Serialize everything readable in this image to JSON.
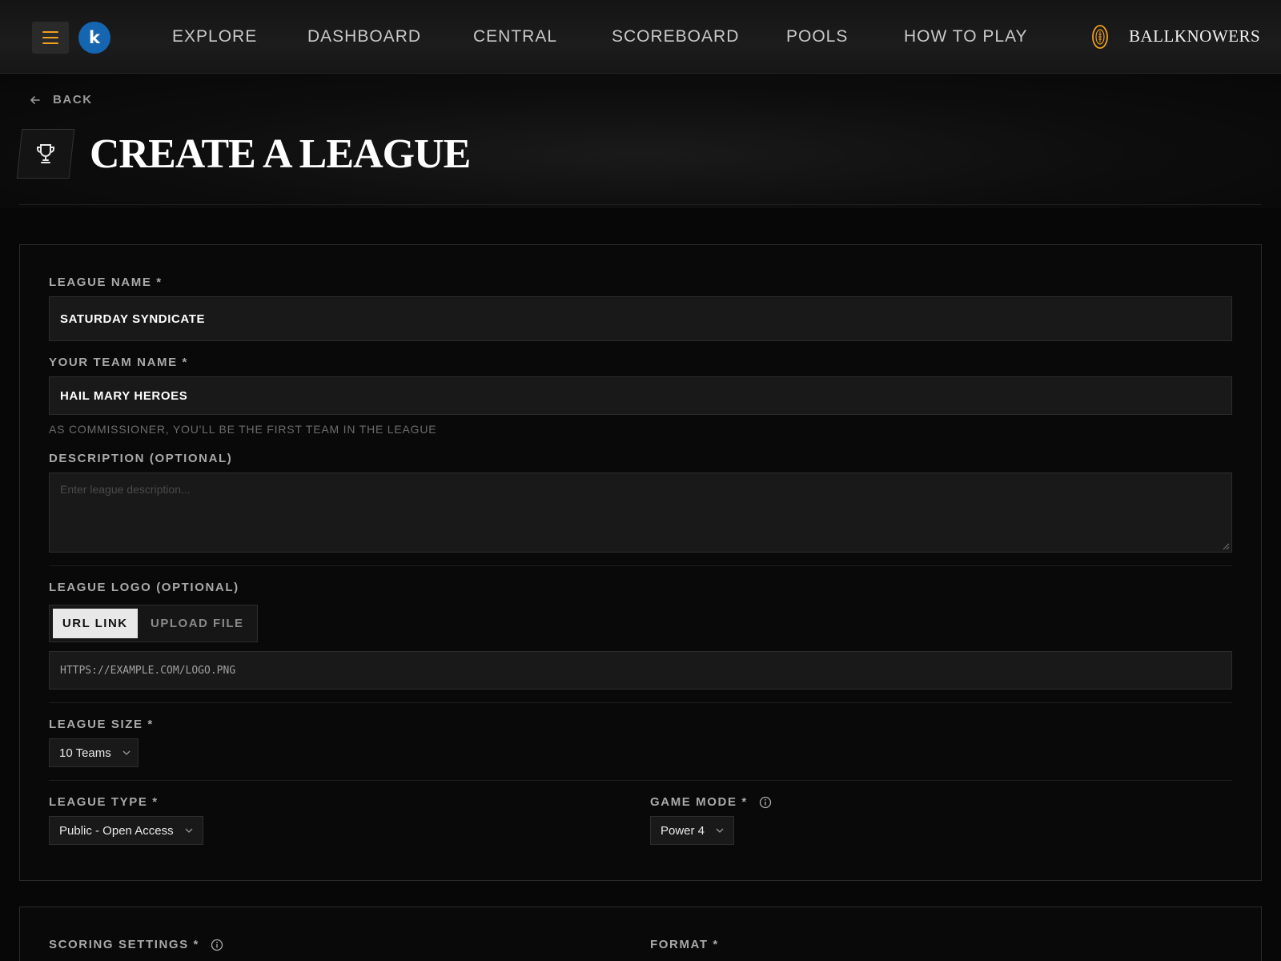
{
  "nav": {
    "avatar_letter": "k",
    "links": [
      "EXPLORE",
      "DASHBOARD",
      "CENTRAL",
      "SCOREBOARD",
      "POOLS",
      "HOW TO PLAY"
    ],
    "brand": "BALLKNOWERS"
  },
  "header": {
    "back_label": "BACK",
    "title": "CREATE A LEAGUE"
  },
  "form": {
    "league_name": {
      "label": "LEAGUE NAME *",
      "value": "SATURDAY SYNDICATE"
    },
    "team_name": {
      "label": "YOUR TEAM NAME *",
      "value": "HAIL MARY HEROES",
      "hint": "AS COMMISSIONER, YOU'LL BE THE FIRST TEAM IN THE LEAGUE"
    },
    "description": {
      "label": "DESCRIPTION (OPTIONAL)",
      "placeholder": "Enter league description..."
    },
    "logo": {
      "label": "LEAGUE LOGO (OPTIONAL)",
      "tabs": [
        "URL LINK",
        "UPLOAD FILE"
      ],
      "active_tab": "URL LINK",
      "url_value": "HTTPS://EXAMPLE.COM/LOGO.PNG"
    },
    "league_size": {
      "label": "LEAGUE SIZE *",
      "value": "10 Teams"
    },
    "league_type": {
      "label": "LEAGUE TYPE *",
      "value": "Public - Open Access"
    },
    "game_mode": {
      "label": "GAME MODE *",
      "value": "Power 4"
    }
  },
  "form2": {
    "scoring": {
      "label": "SCORING SETTINGS *"
    },
    "format": {
      "label": "FORMAT *"
    }
  },
  "colors": {
    "accent": "#f0a020",
    "avatar": "#1565b0",
    "background": "#070707"
  }
}
